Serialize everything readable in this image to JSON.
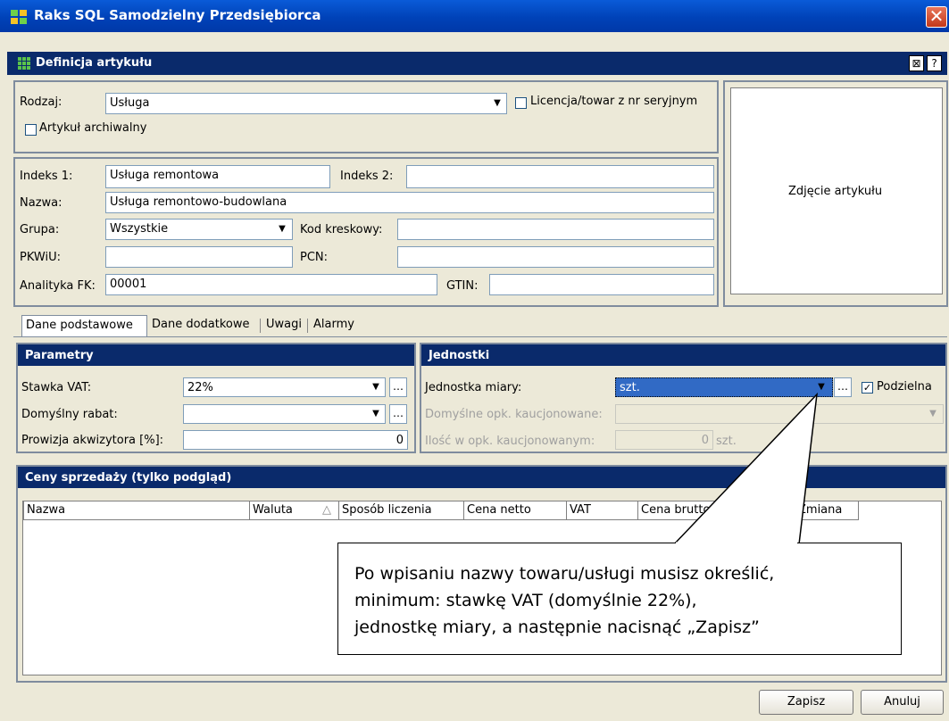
{
  "window": {
    "title": "Raks SQL Samodzielny Przedsiębiorca",
    "close": "✕"
  },
  "header": {
    "title": "Definicja artykułu",
    "btn1": "⊠",
    "btn2": "?"
  },
  "rodzaj": {
    "label": "Rodzaj:",
    "value": "Usługa",
    "licencja_label": "Licencja/towar z nr seryjnym",
    "archiwalny_label": "Artykuł archiwalny"
  },
  "fields": {
    "indeks1_label": "Indeks 1:",
    "indeks1_value": "Usługa remontowa",
    "indeks2_label": "Indeks 2:",
    "indeks2_value": "",
    "nazwa_label": "Nazwa:",
    "nazwa_value": "Usługa remontowo-budowlana",
    "grupa_label": "Grupa:",
    "grupa_value": "Wszystkie",
    "kod_label": "Kod kreskowy:",
    "kod_value": "",
    "pkwiu_label": "PKWiU:",
    "pkwiu_value": "",
    "pcn_label": "PCN:",
    "pcn_value": "",
    "analityka_label": "Analityka FK:",
    "analityka_value": "00001",
    "gtin_label": "GTIN:",
    "gtin_value": ""
  },
  "photo": {
    "label": "Zdjęcie artykułu"
  },
  "tabs": [
    "Dane podstawowe",
    "Dane dodatkowe",
    "Uwagi",
    "Alarmy"
  ],
  "parametry": {
    "title": "Parametry",
    "vat_label": "Stawka VAT:",
    "vat_value": "22%",
    "rabat_label": "Domyślny rabat:",
    "rabat_value": "",
    "prowizja_label": "Prowizja akwizytora [%]:",
    "prowizja_value": "0"
  },
  "jednostki": {
    "title": "Jednostki",
    "jm_label": "Jednostka miary:",
    "jm_value": "szt.",
    "podzielna_label": "Podzielna",
    "opk_label": "Domyślne opk. kaucjonowane:",
    "opk_value": "",
    "ilosc_label": "Ilość w opk. kaucjonowanym:",
    "ilosc_value": "0",
    "ilosc_unit": "szt."
  },
  "ceny": {
    "title": "Ceny sprzedaży (tylko podgląd)",
    "columns": [
      "Nazwa",
      "Waluta",
      "Sposób liczenia",
      "Cena netto",
      "VAT",
      "Cena brutto",
      "Zmiana"
    ],
    "sort_indicator": "△"
  },
  "callout": {
    "line1": "Po wpisaniu nazwy towaru/usługi musisz określić,",
    "line2": "minimum: stawkę VAT (domyślnie 22%),",
    "line3": "jednostkę miary, a następnie nacisnąć „Zapisz”"
  },
  "buttons": {
    "save": "Zapisz",
    "cancel": "Anuluj"
  },
  "colors": {
    "titlebar": "#0042b8",
    "section_header": "#0a2a6b",
    "selection": "#316ac5"
  }
}
